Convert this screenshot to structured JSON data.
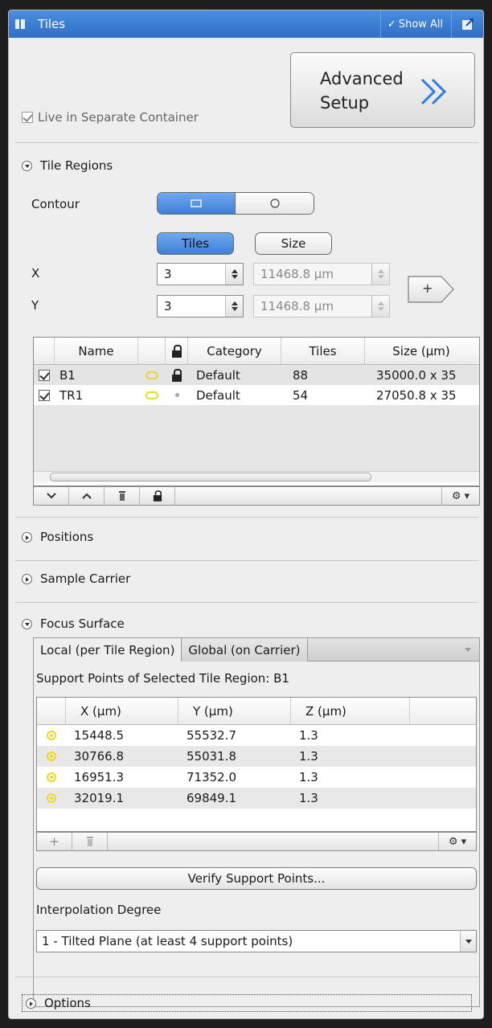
{
  "header": {
    "title": "Tiles",
    "show_all": "Show All"
  },
  "advanced_setup": {
    "line1": "Advanced",
    "line2": "Setup"
  },
  "live_in_separate_container": {
    "label": "Live in Separate Container",
    "checked": true
  },
  "tile_regions": {
    "section_title": "Tile Regions",
    "contour_label": "Contour",
    "contour_options": [
      "rectangle",
      "circle"
    ],
    "contour_selected": "rectangle",
    "mode_tiles": "Tiles",
    "mode_size": "Size",
    "x_label": "X",
    "y_label": "Y",
    "x_tiles": "3",
    "y_tiles": "3",
    "x_size": "11468.8 µm",
    "y_size": "11468.8 µm",
    "add_button": "+",
    "table": {
      "headers": [
        "Name",
        "Category",
        "Tiles",
        "Size (µm)"
      ],
      "rows": [
        {
          "checked": true,
          "name": "B1",
          "locked": true,
          "category": "Default",
          "tiles": "88",
          "size": "35000.0 x 35"
        },
        {
          "checked": true,
          "name": "TR1",
          "locked": false,
          "category": "Default",
          "tiles": "54",
          "size": "27050.8 x 35"
        }
      ]
    }
  },
  "positions": {
    "section_title": "Positions"
  },
  "sample_carrier": {
    "section_title": "Sample Carrier"
  },
  "focus_surface": {
    "section_title": "Focus Surface",
    "tabs": [
      "Local (per Tile Region)",
      "Global (on Carrier)"
    ],
    "active_tab": "Local (per Tile Region)",
    "support_points_label": "Support Points of Selected Tile Region:  B1",
    "table": {
      "headers": [
        "X (µm)",
        "Y (µm)",
        "Z (µm)"
      ],
      "rows": [
        {
          "x": "15448.5",
          "y": "55532.7",
          "z": "1.3"
        },
        {
          "x": "30766.8",
          "y": "55031.8",
          "z": "1.3"
        },
        {
          "x": "16951.3",
          "y": "71352.0",
          "z": "1.3"
        },
        {
          "x": "32019.1",
          "y": "69849.1",
          "z": "1.3"
        }
      ]
    },
    "add_point": "+",
    "verify_button": "Verify Support Points...",
    "interpolation_label": "Interpolation Degree",
    "interpolation_value": "1 - Tilted Plane (at least 4 support points)"
  },
  "options": {
    "section_title": "Options"
  }
}
